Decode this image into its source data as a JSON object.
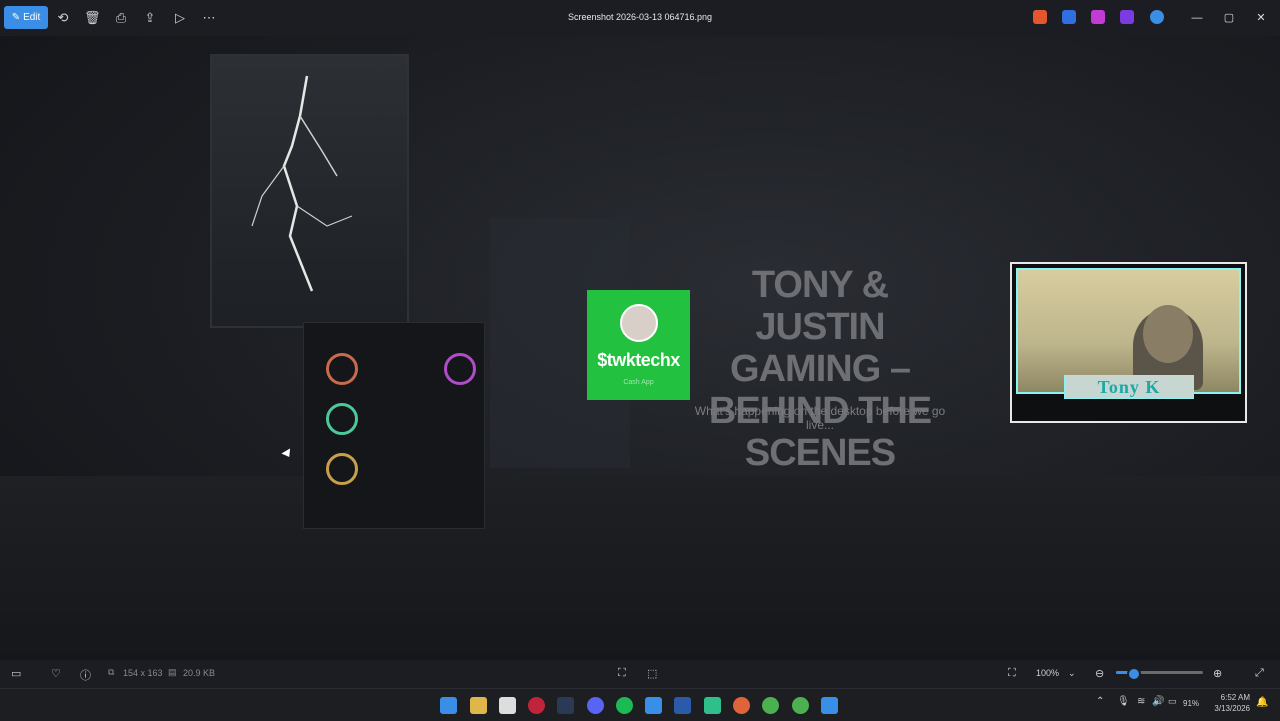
{
  "toolbar": {
    "edit_label": "Edit",
    "title": "Screenshot 2026-03-13 064716.png"
  },
  "canvas": {
    "qr_handle": "$twktechx",
    "qr_sub": "Cash App",
    "stream_title_line1": "TONY & JUSTIN",
    "stream_title_line2": "GAMING –",
    "stream_title_line3": "BEHIND THE SCENES",
    "stream_subtitle": "What's happening on the desktop before we go live...",
    "webcam_name": "Tony K"
  },
  "status": {
    "dimensions": "154 x 163",
    "file_size": "20.9 KB",
    "zoom": "100%",
    "zoom_level_fraction": 0.18
  },
  "taskbar": {
    "time": "6:52 AM",
    "date": "3/13/2026",
    "battery": "91%"
  },
  "colors": {
    "accent": "#3a8ee6",
    "qr_green": "#22c13f",
    "webcam_border": "#8af3f2"
  }
}
